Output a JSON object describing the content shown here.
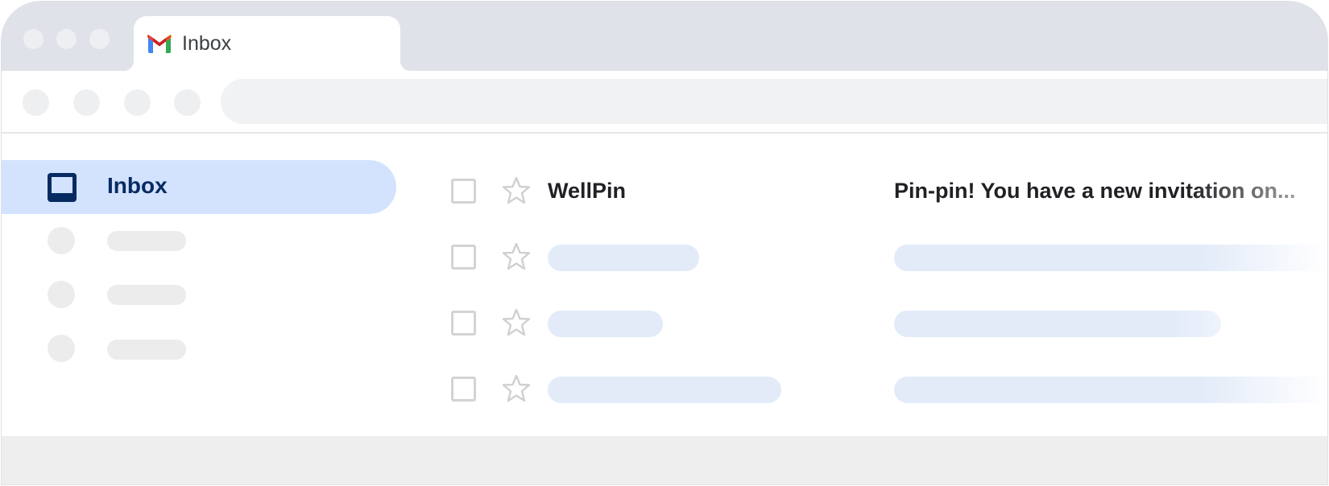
{
  "tab": {
    "title": "Inbox",
    "icon": "gmail-icon"
  },
  "sidebar": {
    "active_label": "Inbox",
    "active_icon": "inbox-icon",
    "active_bg": "#d3e3fd",
    "active_text_color": "#072b61"
  },
  "emails": [
    {
      "sender": "WellPin",
      "subject": "Pin-pin! You have a new invitation on..."
    }
  ],
  "colors": {
    "tabbar": "#dfe2e9",
    "placeholder_blue": "#e3ebf9",
    "placeholder_gray": "#ececec"
  }
}
